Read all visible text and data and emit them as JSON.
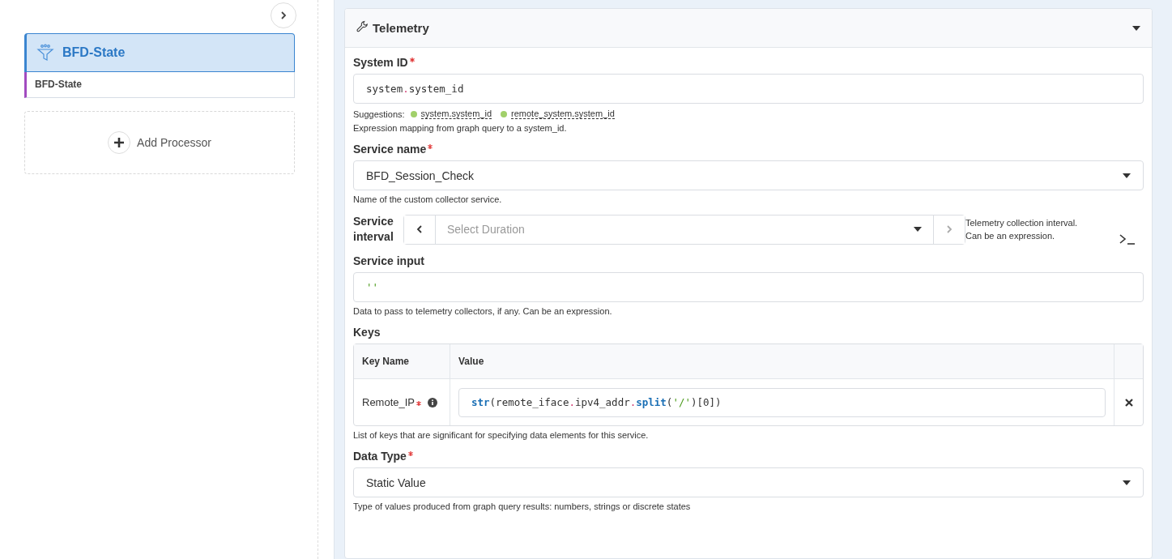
{
  "sidebar": {
    "processor": {
      "title": "BFD-State",
      "selected": true,
      "child": "BFD-State"
    },
    "add_label": "Add Processor"
  },
  "panel": {
    "title": "Telemetry",
    "expanded": true,
    "fields": [
      {
        "kind": "code",
        "label": "System ID",
        "required": true,
        "tokens": [
          {
            "text": "system",
            "kind": "plain"
          },
          {
            "text": ".",
            "kind": "dot"
          },
          {
            "text": "system_id",
            "kind": "plain"
          }
        ],
        "suggestions_label": "Suggestions:",
        "suggestions": [
          "system.system_id",
          "remote_system.system_id"
        ],
        "help": "Expression mapping from graph query to a system_id."
      },
      {
        "kind": "select",
        "label": "Service name",
        "required": true,
        "value": "BFD_Session_Check",
        "help": "Name of the custom collector service."
      },
      {
        "kind": "duration",
        "label": "Service interval",
        "required": false,
        "placeholder": "Select Duration",
        "help_lines": [
          "Telemetry collection interval.",
          "Can be an expression."
        ]
      },
      {
        "kind": "code",
        "label": "Service input",
        "required": false,
        "tokens": [
          {
            "text": "''",
            "kind": "string"
          }
        ],
        "help": "Data to pass to telemetry collectors, if any. Can be an expression."
      },
      {
        "kind": "keys",
        "label": "Keys",
        "required": false,
        "columns": [
          "Key Name",
          "Value"
        ],
        "rows": [
          {
            "name": "Remote_IP",
            "required": true,
            "tokens": [
              {
                "text": "str",
                "kind": "func"
              },
              {
                "text": "(remote_iface",
                "kind": "plain"
              },
              {
                "text": ".",
                "kind": "dot"
              },
              {
                "text": "ipv4_addr",
                "kind": "plain"
              },
              {
                "text": ".",
                "kind": "dot"
              },
              {
                "text": "split",
                "kind": "func"
              },
              {
                "text": "(",
                "kind": "plain"
              },
              {
                "text": "'/'",
                "kind": "string"
              },
              {
                "text": ")[0])",
                "kind": "plain"
              }
            ]
          }
        ],
        "help": "List of keys that are significant for specifying data elements for this service."
      },
      {
        "kind": "select",
        "label": "Data Type",
        "required": true,
        "value": "Static Value",
        "help": "Type of values produced from graph query results: numbers, strings or discrete states"
      }
    ]
  }
}
